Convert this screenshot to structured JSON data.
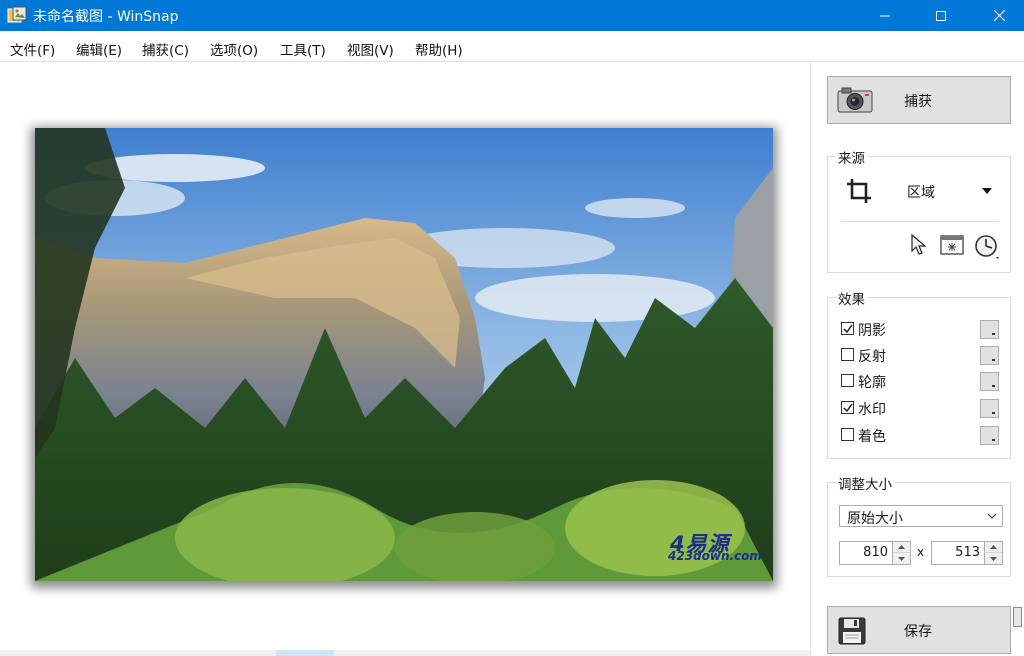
{
  "window": {
    "title": "未命名截图 - WinSnap",
    "accent_color": "#0078d7"
  },
  "menu": {
    "items": [
      "文件(F)",
      "编辑(E)",
      "捕获(C)",
      "选项(O)",
      "工具(T)",
      "视图(V)",
      "帮助(H)"
    ]
  },
  "panel": {
    "capture_label": "捕获",
    "save_label": "保存",
    "source": {
      "title": "来源",
      "mode": "区域",
      "icons": [
        "crop-icon",
        "cursor-icon",
        "window-capture-icon",
        "timer-icon"
      ]
    },
    "effects": {
      "title": "效果",
      "items": [
        {
          "label": "阴影",
          "checked": true
        },
        {
          "label": "反射",
          "checked": false
        },
        {
          "label": "轮廓",
          "checked": false
        },
        {
          "label": "水印",
          "checked": true
        },
        {
          "label": "着色",
          "checked": false
        }
      ]
    },
    "resize": {
      "title": "调整大小",
      "mode": "原始大小",
      "width": "810",
      "height": "513",
      "times": "x"
    }
  },
  "canvas": {
    "watermark_big": "4易源",
    "watermark_small": "423down.com"
  }
}
